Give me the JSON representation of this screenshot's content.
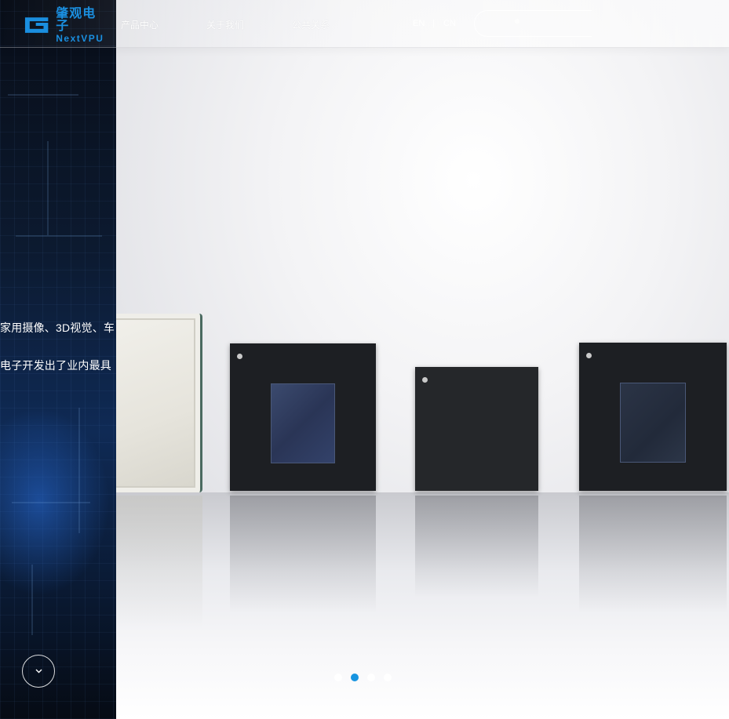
{
  "header": {
    "logo": {
      "cn": "肇观电子",
      "en": "NextVPU"
    },
    "nav": [
      {
        "label": "产品中心"
      },
      {
        "label": "关于我们"
      },
      {
        "label": "公共关系"
      }
    ],
    "lang": {
      "en": "EN",
      "sep": "|",
      "cn": "CN"
    }
  },
  "hero": {
    "side_lines": [
      "家用摄像、3D视觉、车",
      "电子开发出了业内最具"
    ],
    "scroll_icon": "chevron-down-icon",
    "carousel": {
      "count": 4,
      "active_index": 1
    }
  },
  "colors": {
    "brand": "#1a8fe0",
    "dot_active": "#1794e0",
    "panel_dark": "#0c1a30"
  }
}
